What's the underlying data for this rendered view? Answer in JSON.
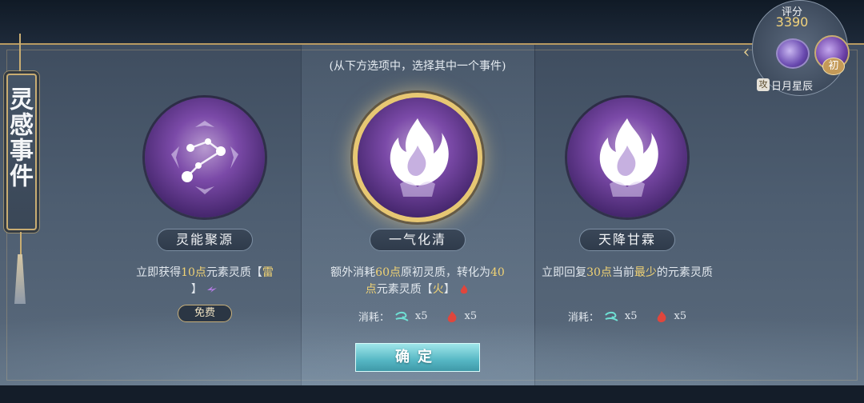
{
  "banner": {
    "title": "灵感事件"
  },
  "instruction": "(从下方选项中，选择其中一个事件)",
  "score": {
    "label": "评分",
    "value": "3390"
  },
  "character": {
    "badge": "初",
    "skill_tag": "攻",
    "skill_name": "日月星辰"
  },
  "options": [
    {
      "name": "灵能聚源",
      "icon": "constellation-icon",
      "desc_parts": [
        "立即获得",
        "10点",
        "元素灵质【",
        "雷",
        "】"
      ],
      "free_label": "免费",
      "element_icon": "thunder-icon"
    },
    {
      "name": "一气化清",
      "icon": "flame-hand-icon",
      "selected": true,
      "desc_parts": [
        "额外消耗",
        "60点",
        "原初灵质，转化为",
        "40点",
        "元素灵质【",
        "火",
        "】"
      ],
      "element_icon": "fire-icon",
      "cost_label": "消耗：",
      "costs": [
        {
          "icon": "wind-icon",
          "amount": "x5"
        },
        {
          "icon": "fire-icon",
          "amount": "x5"
        }
      ],
      "confirm_label": "确定"
    },
    {
      "name": "天降甘霖",
      "icon": "flame-hand-icon",
      "desc_parts": [
        "立即回复",
        "30点",
        "当前",
        "最少",
        "的元素灵质"
      ],
      "cost_label": "消耗：",
      "costs": [
        {
          "icon": "wind-icon",
          "amount": "x5"
        },
        {
          "icon": "fire-icon",
          "amount": "x5"
        }
      ]
    }
  ],
  "colors": {
    "highlight": "#f0d274",
    "gold": "#c9ad72",
    "orb": "#7b4aa8",
    "confirm": "#56b7c4"
  }
}
